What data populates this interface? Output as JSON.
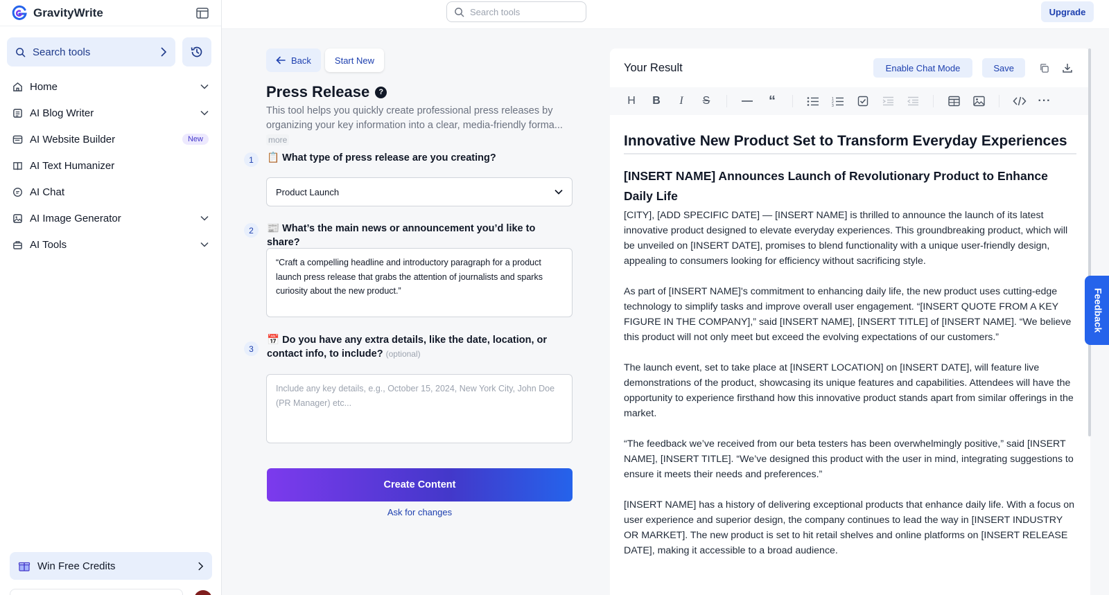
{
  "app": {
    "name": "GravityWrite"
  },
  "sidebar": {
    "search_label": "Search tools",
    "items": [
      {
        "label": "Home",
        "icon": "home-icon",
        "chevron": true
      },
      {
        "label": "AI Blog Writer",
        "icon": "document-icon",
        "chevron": true
      },
      {
        "label": "AI Website Builder",
        "icon": "browser-icon",
        "badge": "New"
      },
      {
        "label": "AI Text Humanizer",
        "icon": "book-icon"
      },
      {
        "label": "AI Chat",
        "icon": "chat-icon"
      },
      {
        "label": "AI Image Generator",
        "icon": "image-icon",
        "chevron": true
      },
      {
        "label": "AI Tools",
        "icon": "toolbox-icon",
        "chevron": true
      }
    ],
    "credits_label": "Win Free Credits"
  },
  "topbar": {
    "search_placeholder": "Search tools",
    "upgrade_label": "Upgrade"
  },
  "form": {
    "back_label": "Back",
    "start_new_label": "Start New",
    "title": "Press Release",
    "description": "This tool helps you quickly create professional press releases by organizing your key information into a clear, media-friendly forma...",
    "more_label": "more",
    "steps": [
      {
        "num": "1",
        "emoji": "📋",
        "question": "What type of press release are you creating?"
      },
      {
        "num": "2",
        "emoji": "📰",
        "question": "What’s the main news or announcement you’d like to share?"
      },
      {
        "num": "3",
        "emoji": "📅",
        "question": "Do you have any extra details, like the date, location, or contact info, to include?",
        "optional": "(optional)"
      }
    ],
    "select_value": "Product Launch",
    "announcement_value": "“Craft a compelling headline and introductory paragraph for a product launch press release that grabs the attention of journalists and sparks curiosity about the new product.”",
    "details_placeholder": "Include any key details, e.g., October 15, 2024, New York City, John Doe (PR Manager) etc...",
    "create_label": "Create Content",
    "ask_label": "Ask for changes"
  },
  "result": {
    "title": "Your Result",
    "chat_mode_label": "Enable Chat Mode",
    "save_label": "Save",
    "h1": "Innovative New Product Set to Transform Everyday Experiences",
    "h2": "[INSERT NAME] Announces Launch of Revolutionary Product to Enhance Daily Life",
    "paragraphs": [
      "[CITY], [ADD SPECIFIC DATE] — [INSERT NAME] is thrilled to announce the launch of its latest innovative product designed to elevate everyday experiences. This groundbreaking product, which will be unveiled on [INSERT DATE], promises to blend functionality with a unique user-friendly design, appealing to consumers looking for efficiency without sacrificing style.",
      "As part of [INSERT NAME]'s commitment to enhancing daily life, the new product uses cutting-edge technology to simplify tasks and improve overall user engagement. “[INSERT QUOTE FROM A KEY FIGURE IN THE COMPANY],” said [INSERT NAME], [INSERT TITLE] of [INSERT NAME]. “We believe this product will not only meet but exceed the evolving expectations of our customers.”",
      "The launch event, set to take place at [INSERT LOCATION] on [INSERT DATE], will feature live demonstrations of the product, showcasing its unique features and capabilities. Attendees will have the opportunity to experience firsthand how this innovative product stands apart from similar offerings in the market.",
      "“The feedback we’ve received from our beta testers has been overwhelmingly positive,” said [INSERT NAME], [INSERT TITLE]. “We’ve designed this product with the user in mind, integrating suggestions to ensure it meets their needs and preferences.”",
      "[INSERT NAME] has a history of delivering exceptional products that enhance daily life. With a focus on user experience and superior design, the company continues to lead the way in [INSERT INDUSTRY OR MARKET]. The new product is set to hit retail shelves and online platforms on [INSERT RELEASE DATE], making it accessible to a broad audience."
    ]
  },
  "feedback_label": "Feedback",
  "colors": {
    "accent": "#2563eb",
    "accent_soft": "#e8effc",
    "gradient_start": "#7c3aed",
    "gradient_end": "#2563eb"
  }
}
